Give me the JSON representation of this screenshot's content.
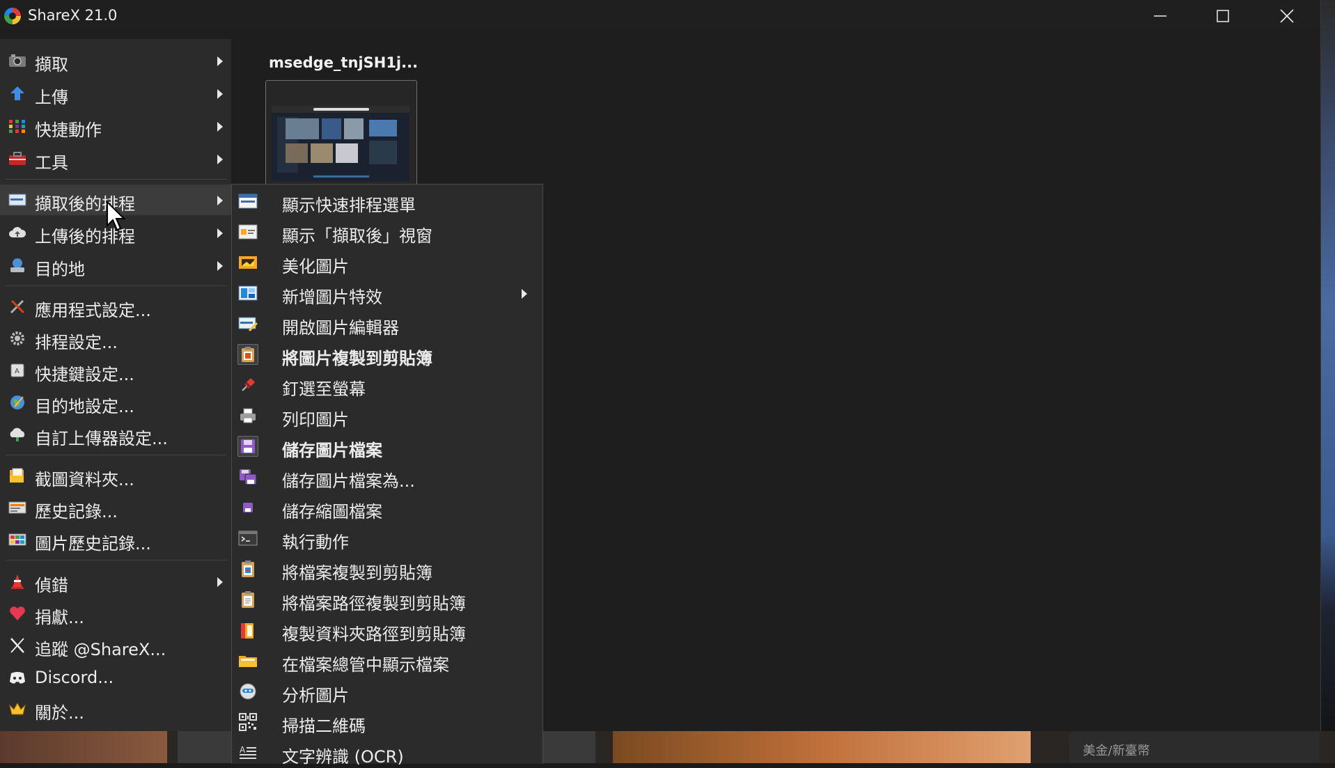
{
  "window": {
    "title": "ShareX 21.0"
  },
  "thumbnail": {
    "title": "msedge_tnjSH1j..."
  },
  "background": {
    "currency_text": "美金/新臺幣"
  },
  "main_menu": [
    {
      "label": "擷取",
      "icon": "camera-icon",
      "submenu": true
    },
    {
      "label": "上傳",
      "icon": "upload-arrow-icon",
      "submenu": true
    },
    {
      "label": "快捷動作",
      "icon": "grid-dots-icon",
      "submenu": true
    },
    {
      "label": "工具",
      "icon": "toolbox-icon",
      "submenu": true
    },
    {
      "label": "擷取後的排程",
      "icon": "after-capture-icon",
      "submenu": true,
      "active": true
    },
    {
      "label": "上傳後的排程",
      "icon": "cloud-icon",
      "submenu": true
    },
    {
      "label": "目的地",
      "icon": "destination-icon",
      "submenu": true
    },
    {
      "label": "應用程式設定...",
      "icon": "wrench-icon"
    },
    {
      "label": "排程設定...",
      "icon": "gear-icon"
    },
    {
      "label": "快捷鍵設定...",
      "icon": "keyboard-icon"
    },
    {
      "label": "目的地設定...",
      "icon": "globe-icon"
    },
    {
      "label": "自訂上傳器設定...",
      "icon": "cloud-upload-icon"
    },
    {
      "label": "截圖資料夾...",
      "icon": "folder-icon"
    },
    {
      "label": "歷史記錄...",
      "icon": "history-icon"
    },
    {
      "label": "圖片歷史記錄...",
      "icon": "image-history-icon"
    },
    {
      "label": "偵錯",
      "icon": "traffic-cone-icon",
      "submenu": true
    },
    {
      "label": "捐獻...",
      "icon": "heart-icon"
    },
    {
      "label": "追蹤 @ShareX...",
      "icon": "x-logo-icon"
    },
    {
      "label": "Discord...",
      "icon": "discord-icon"
    },
    {
      "label": "關於...",
      "icon": "crown-icon"
    }
  ],
  "submenu": [
    {
      "label": "顯示快速排程選單",
      "icon": "quick-menu-icon"
    },
    {
      "label": "顯示「擷取後」視窗",
      "icon": "window-icon"
    },
    {
      "label": "美化圖片",
      "icon": "beautify-icon"
    },
    {
      "label": "新增圖片特效",
      "icon": "effects-icon",
      "submenu": true
    },
    {
      "label": "開啟圖片編輯器",
      "icon": "image-editor-icon"
    },
    {
      "label": "將圖片複製到剪貼簿",
      "icon": "clipboard-image-icon",
      "checked": true
    },
    {
      "label": "釘選至螢幕",
      "icon": "pin-icon"
    },
    {
      "label": "列印圖片",
      "icon": "printer-icon"
    },
    {
      "label": "儲存圖片檔案",
      "icon": "save-icon",
      "checked": true
    },
    {
      "label": "儲存圖片檔案為...",
      "icon": "save-as-icon"
    },
    {
      "label": "儲存縮圖檔案",
      "icon": "save-thumbnail-icon"
    },
    {
      "label": "執行動作",
      "icon": "terminal-icon"
    },
    {
      "label": "將檔案複製到剪貼簿",
      "icon": "clipboard-file-icon"
    },
    {
      "label": "將檔案路徑複製到剪貼簿",
      "icon": "clipboard-path-icon"
    },
    {
      "label": "複製資料夾路徑到剪貼簿",
      "icon": "folder-path-icon"
    },
    {
      "label": "在檔案總管中顯示檔案",
      "icon": "explorer-folder-icon"
    },
    {
      "label": "分析圖片",
      "icon": "analyze-icon"
    },
    {
      "label": "掃描二維碼",
      "icon": "qr-code-icon"
    },
    {
      "label": "文字辨識 (OCR)",
      "icon": "ocr-icon"
    }
  ]
}
